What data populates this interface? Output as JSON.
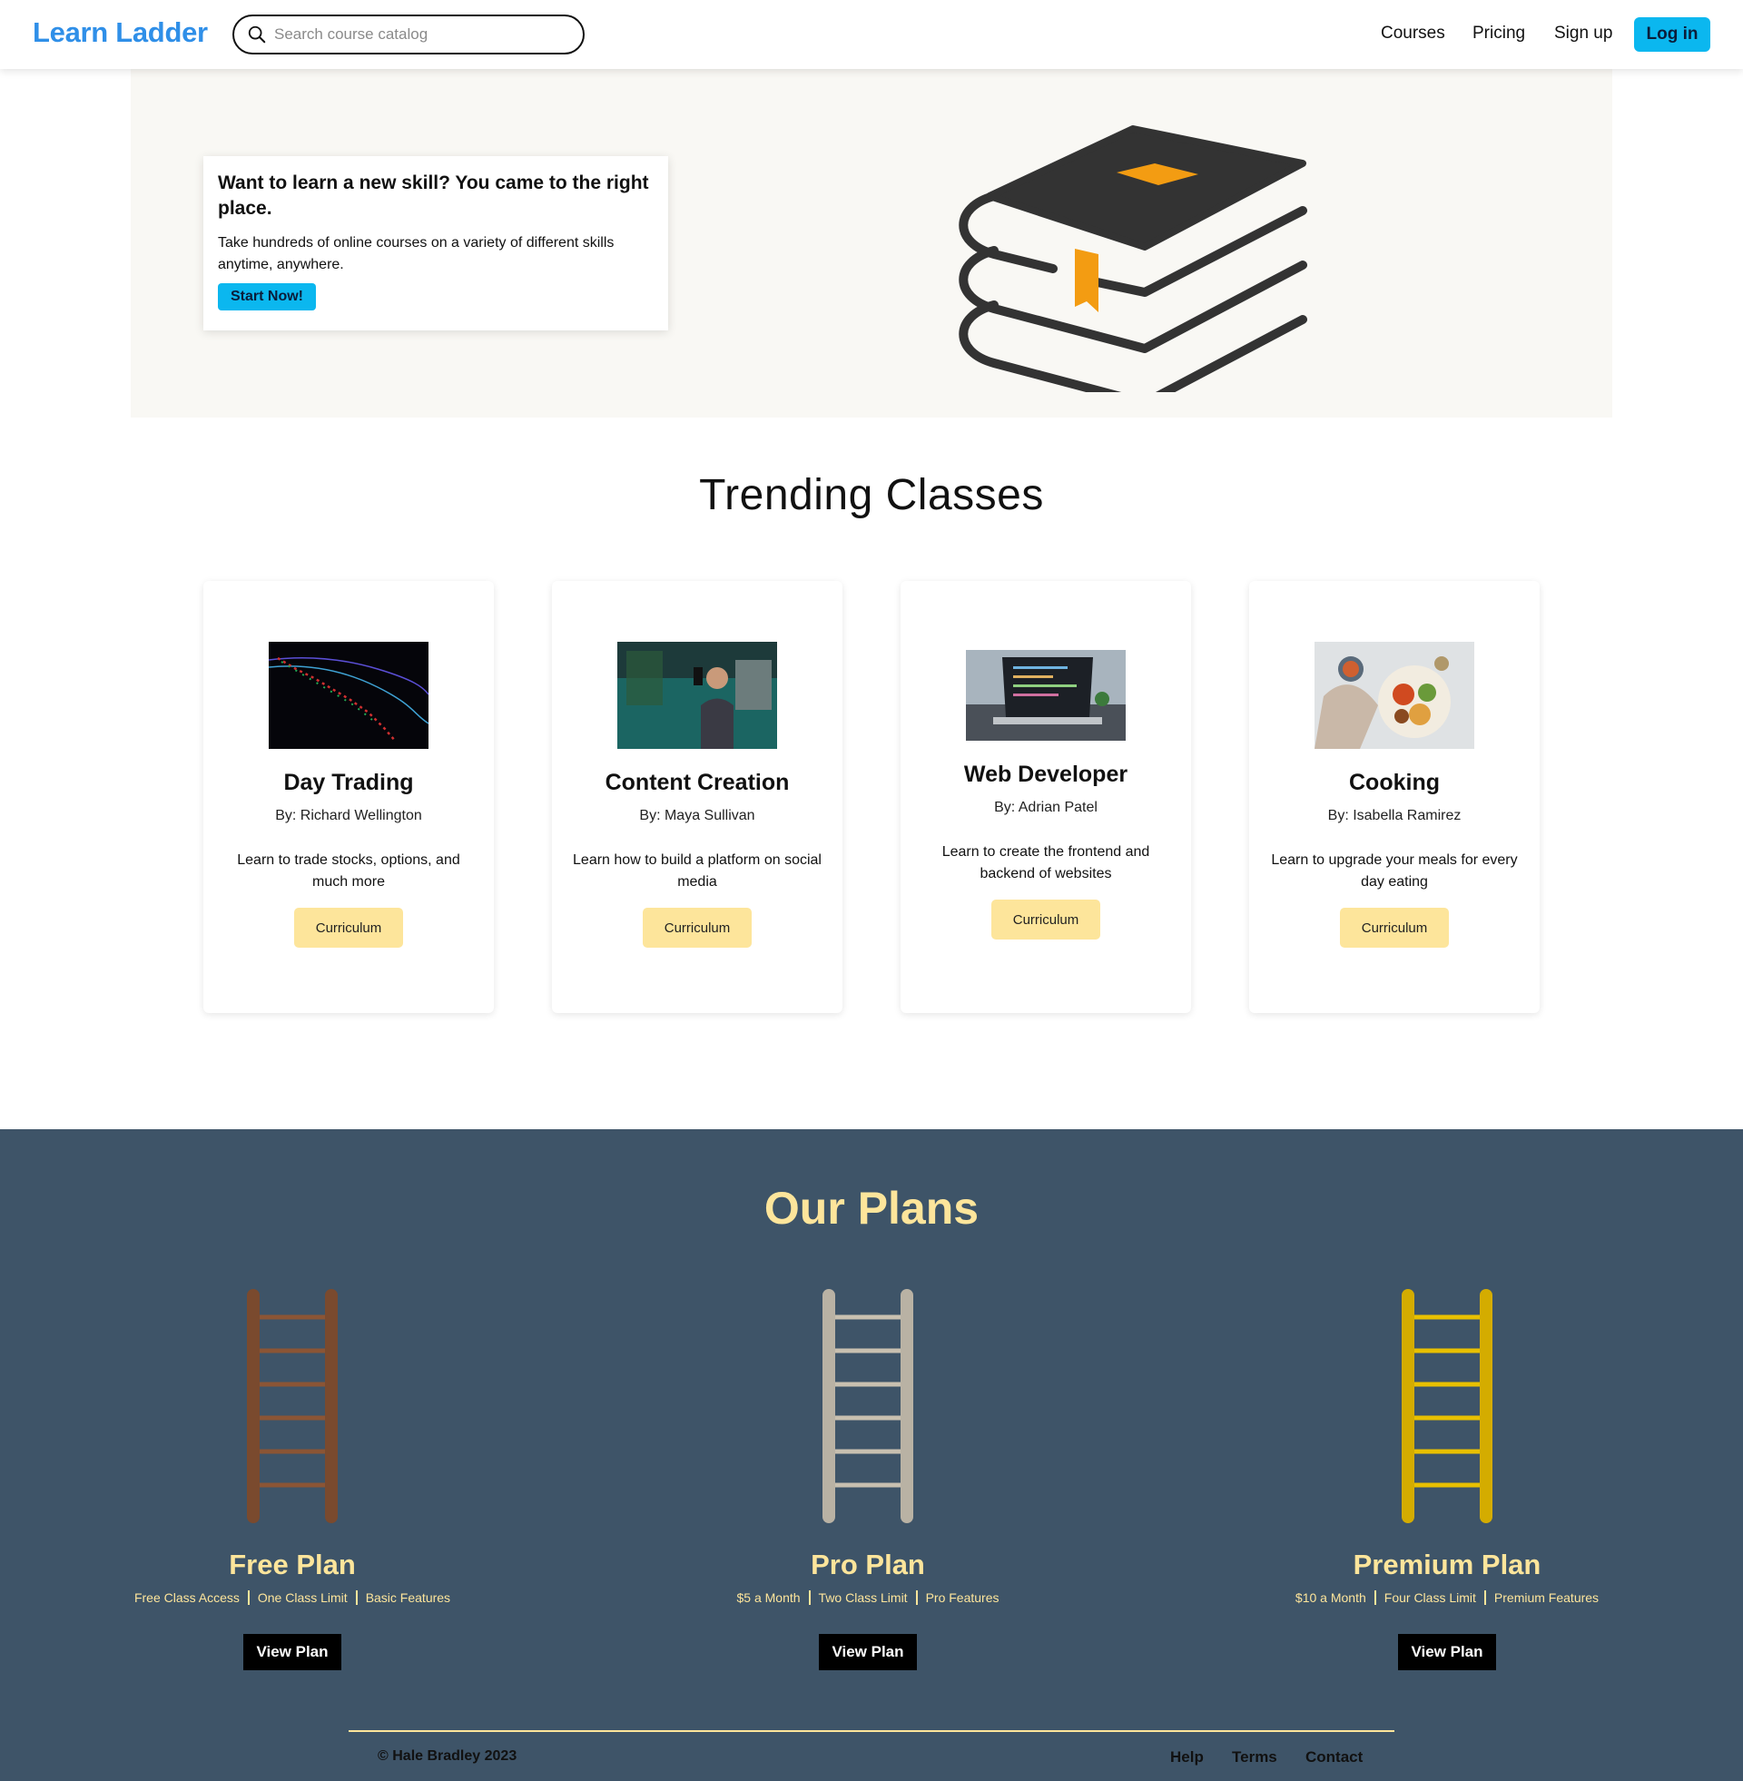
{
  "nav": {
    "brand": "Learn Ladder",
    "search_placeholder": "Search course catalog",
    "links": [
      "Courses",
      "Pricing",
      "Sign up"
    ],
    "login": "Log in"
  },
  "hero": {
    "title": "Want to learn a new skill? You came to the right place.",
    "text": "Take hundreds of online courses on a variety of different skills anytime, anywhere.",
    "cta": "Start Now!"
  },
  "trending": {
    "title": "Trending Classes",
    "courses": [
      {
        "name": "Day Trading",
        "author": "By: Richard Wellington",
        "desc": "Learn to trade stocks, options, and much more",
        "button": "Curriculum"
      },
      {
        "name": "Content Creation",
        "author": "By: Maya Sullivan",
        "desc": "Learn how to build a platform on social media",
        "button": "Curriculum"
      },
      {
        "name": "Web Developer",
        "author": "By: Adrian Patel",
        "desc": "Learn to create the frontend and backend of websites",
        "button": "Curriculum"
      },
      {
        "name": "Cooking",
        "author": "By: Isabella Ramirez",
        "desc": "Learn to upgrade your meals for every day eating",
        "button": "Curriculum"
      }
    ]
  },
  "plans": {
    "title": "Our Plans",
    "items": [
      {
        "name": "Free Plan",
        "features": [
          "Free Class Access",
          "One Class Limit",
          "Basic Features"
        ],
        "button": "View Plan"
      },
      {
        "name": "Pro Plan",
        "features": [
          "$5 a Month",
          "Two Class Limit",
          "Pro Features"
        ],
        "button": "View Plan"
      },
      {
        "name": "Premium Plan",
        "features": [
          "$10 a Month",
          "Four Class Limit",
          "Premium Features"
        ],
        "button": "View Plan"
      }
    ]
  },
  "footer": {
    "copyright": "© Hale Bradley 2023",
    "links": [
      "Help",
      "Terms",
      "Contact"
    ]
  },
  "colors": {
    "brand_blue": "#2f8fe8",
    "accent_cyan": "#0bb7ef",
    "cream": "#fde59b",
    "plans_bg": "#3e5468",
    "bronze": "#8b5535",
    "silver": "#c8c0b0",
    "gold": "#e8c000"
  }
}
